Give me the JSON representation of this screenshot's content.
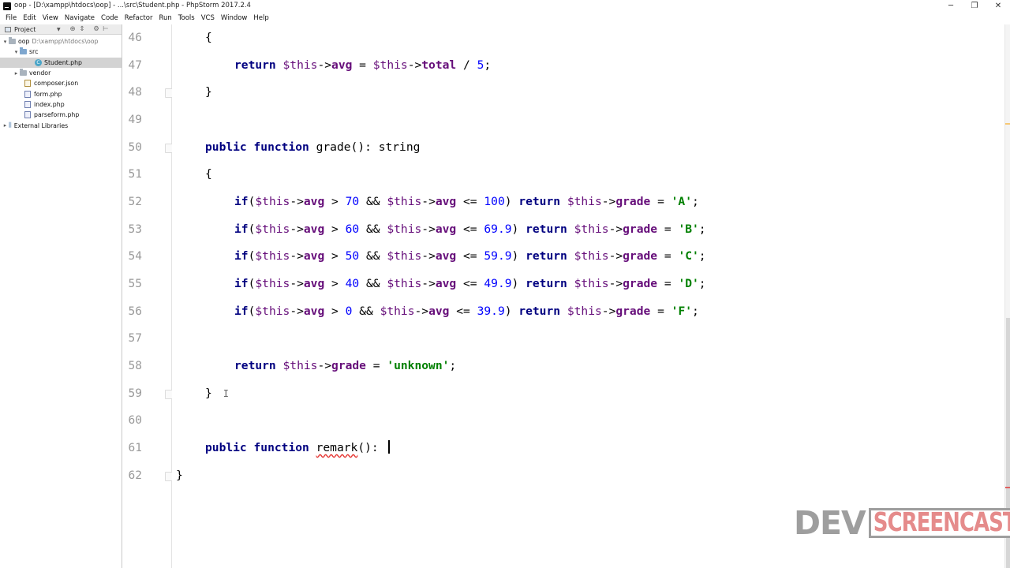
{
  "window": {
    "title": "oop - [D:\\xampp\\htdocs\\oop] - ...\\src\\Student.php - PhpStorm 2017.2.4",
    "minimize_glyph": "─",
    "restore_glyph": "❐",
    "close_glyph": "✕"
  },
  "menu": [
    "File",
    "Edit",
    "View",
    "Navigate",
    "Code",
    "Refactor",
    "Run",
    "Tools",
    "VCS",
    "Window",
    "Help"
  ],
  "project_panel": {
    "title": "Project",
    "tree": {
      "root_name": "oop",
      "root_path": "D:\\xampp\\htdocs\\oop",
      "src": "src",
      "student_file": "Student.php",
      "vendor": "vendor",
      "composer": "composer.json",
      "form": "form.php",
      "index": "index.php",
      "parseform": "parseform.php",
      "external": "External Libraries"
    }
  },
  "editor": {
    "lines": {
      "l46": "46",
      "l47": "47",
      "l48": "48",
      "l49": "49",
      "l50": "50",
      "l51": "51",
      "l52": "52",
      "l53": "53",
      "l54": "54",
      "l55": "55",
      "l56": "56",
      "l57": "57",
      "l58": "58",
      "l59": "59",
      "l60": "60",
      "l61": "61",
      "l62": "62"
    },
    "current_line": 61,
    "code": {
      "open_brace": "{",
      "close_brace": "}",
      "return_kw": "return",
      "this": "$this",
      "arrow": "->",
      "avg": "avg",
      "total": "total",
      "eq": " = ",
      "div": " / ",
      "five": "5",
      "semi": ";",
      "public_kw": "public",
      "function_kw": "function",
      "grade_fn": "grade",
      "remark_fn": "remark",
      "sig_tail": "(): ",
      "string_type": "string",
      "if_kw": "if",
      "gt": " > ",
      "and": " && ",
      "lte": " <= ",
      "grade_prop": "grade",
      "n70": "70",
      "n100": "100",
      "strA": "'A'",
      "n60": "60",
      "n699": "69.9",
      "strB": "'B'",
      "n50": "50",
      "n599": "59.9",
      "strC": "'C'",
      "n40": "40",
      "n499": "49.9",
      "strD": "'D'",
      "n0": "0",
      "n399": "39.9",
      "strF": "'F'",
      "unknown": "'unknown'"
    }
  },
  "watermark": {
    "part1": "DEV",
    "part2": "SCREENCAST"
  },
  "colors": {
    "keyword": "#000080",
    "string": "#008000",
    "number": "#0000ff",
    "variable": "#660e7a",
    "current_line": "#fffbe0",
    "error_squiggle": "#e53935"
  }
}
